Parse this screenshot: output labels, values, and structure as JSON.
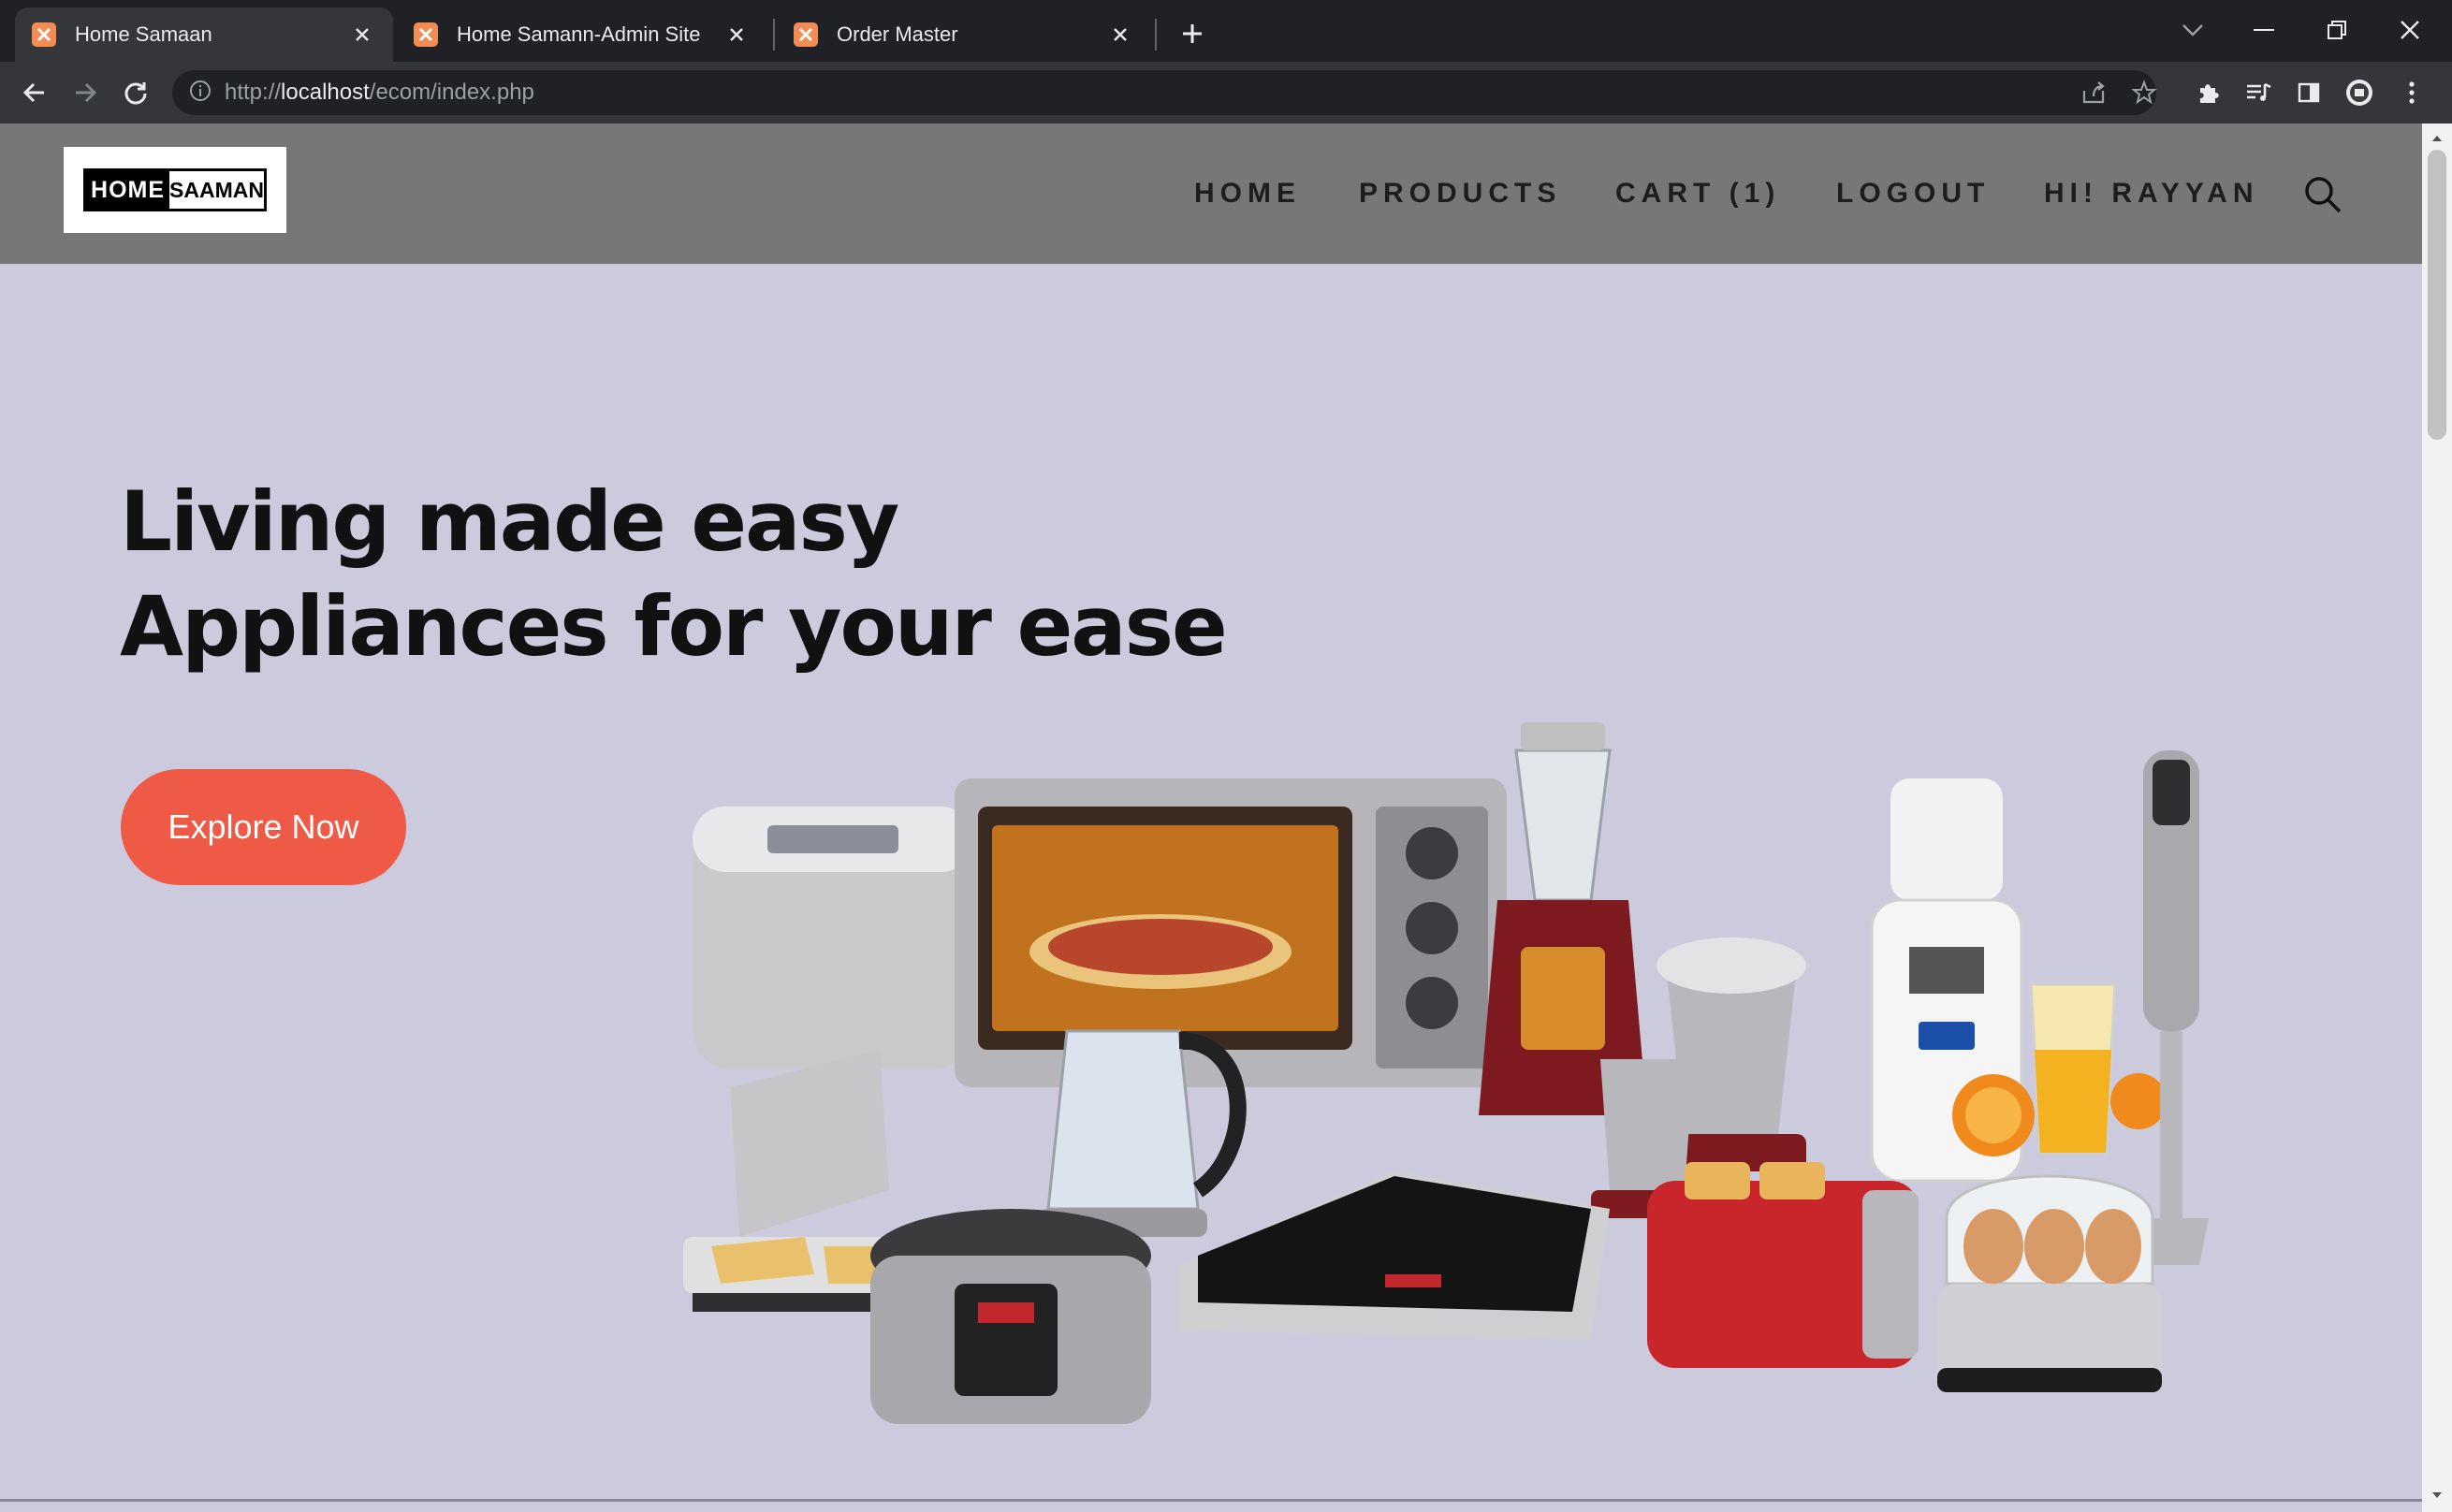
{
  "browser": {
    "tabs": [
      {
        "title": "Home Samaan",
        "active": true
      },
      {
        "title": "Home Samann-Admin Site",
        "active": false
      },
      {
        "title": "Order Master",
        "active": false
      }
    ],
    "url_prefix": "http://",
    "url_host": "localhost",
    "url_path": "/ecom/index.php"
  },
  "site": {
    "logo": {
      "left": "HOME",
      "right": "SAAMAN"
    },
    "nav": [
      "HOME",
      "PRODUCTS",
      "CART (1)",
      "LOGOUT",
      "HI! RAYYAN"
    ],
    "hero": {
      "line1": "Living made easy",
      "line2": "Appliances for your ease",
      "cta": "Explore Now"
    }
  },
  "colors": {
    "header_bg": "#777778",
    "page_bg": "#cccbde",
    "cta_bg": "#ef5a46",
    "favicon": "#f28b54"
  }
}
